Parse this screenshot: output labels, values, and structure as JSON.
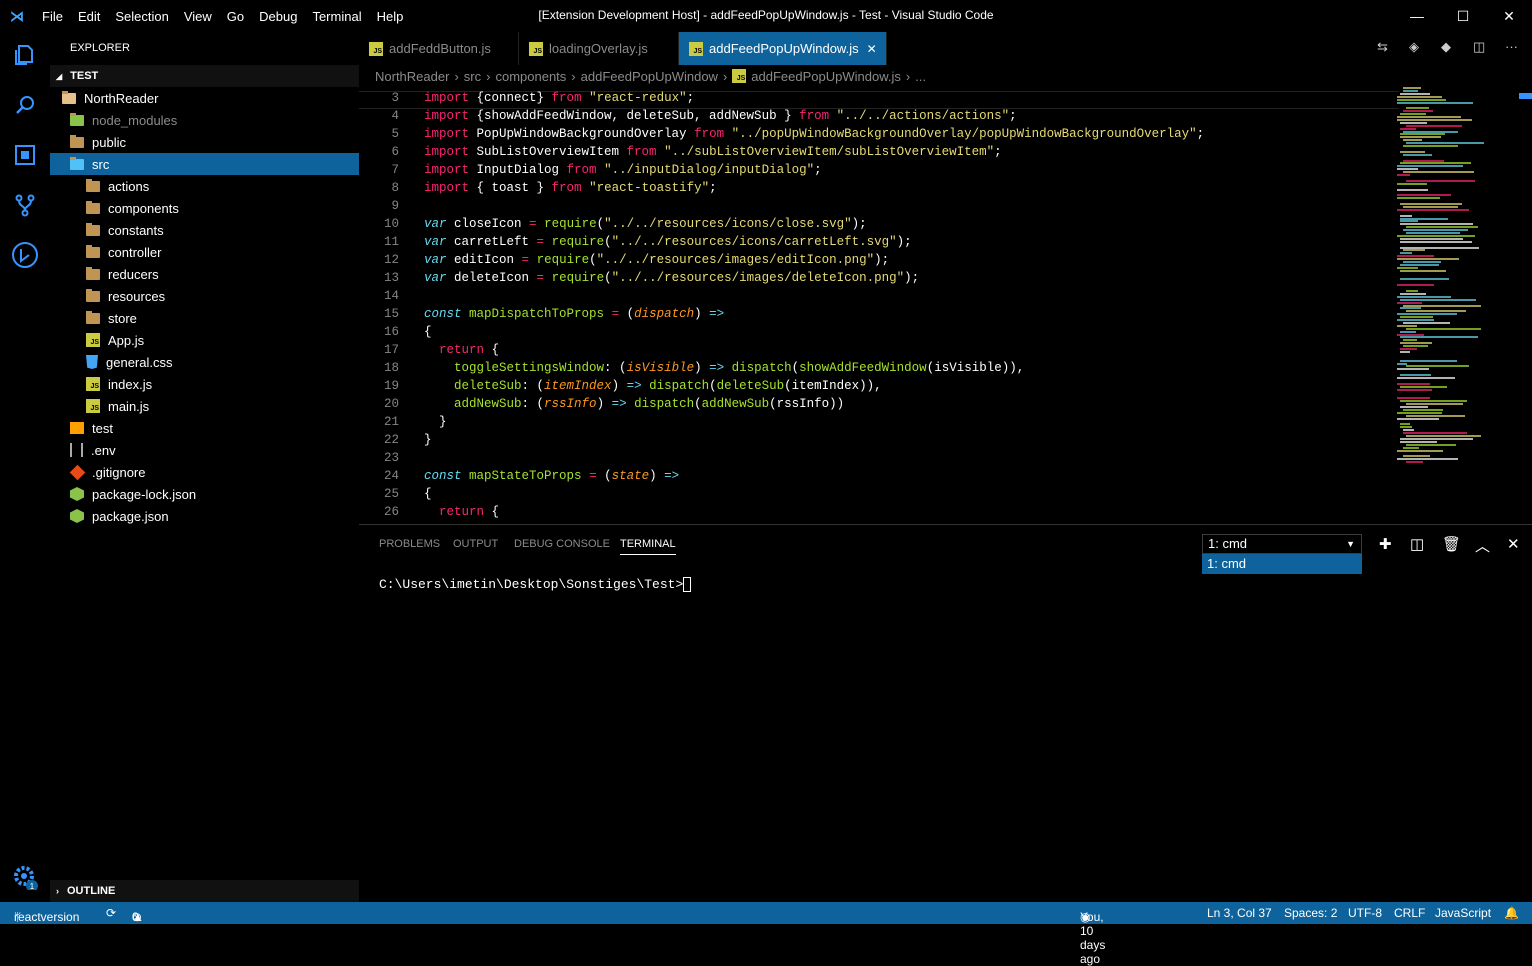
{
  "titlebar": {
    "menu": [
      "File",
      "Edit",
      "Selection",
      "View",
      "Go",
      "Debug",
      "Terminal",
      "Help"
    ],
    "title": "[Extension Development Host] - addFeedPopUpWindow.js - Test - Visual Studio Code"
  },
  "sidebar": {
    "title": "EXPLORER",
    "section": "TEST",
    "outline": "OUTLINE",
    "items": [
      {
        "label": "NorthReader",
        "type": "folder-open",
        "depth": 0
      },
      {
        "label": "node_modules",
        "type": "node-folder",
        "depth": 1,
        "dim": true
      },
      {
        "label": "public",
        "type": "folder",
        "depth": 1
      },
      {
        "label": "src",
        "type": "src-folder",
        "depth": 1,
        "selected": true
      },
      {
        "label": "actions",
        "type": "folder",
        "depth": 2
      },
      {
        "label": "components",
        "type": "folder",
        "depth": 2
      },
      {
        "label": "constants",
        "type": "folder",
        "depth": 2
      },
      {
        "label": "controller",
        "type": "folder",
        "depth": 2
      },
      {
        "label": "reducers",
        "type": "folder",
        "depth": 2
      },
      {
        "label": "resources",
        "type": "folder",
        "depth": 2
      },
      {
        "label": "store",
        "type": "folder",
        "depth": 2
      },
      {
        "label": "App.js",
        "type": "js",
        "depth": 2
      },
      {
        "label": "general.css",
        "type": "css",
        "depth": 2
      },
      {
        "label": "index.js",
        "type": "js",
        "depth": 2
      },
      {
        "label": "main.js",
        "type": "js",
        "depth": 2
      },
      {
        "label": "test",
        "type": "test",
        "depth": 1
      },
      {
        "label": ".env",
        "type": "env",
        "depth": 1
      },
      {
        "label": ".gitignore",
        "type": "git",
        "depth": 1
      },
      {
        "label": "package-lock.json",
        "type": "node",
        "depth": 1
      },
      {
        "label": "package.json",
        "type": "node",
        "depth": 1
      }
    ]
  },
  "tabs": [
    {
      "label": "addFeddButton.js",
      "active": false
    },
    {
      "label": "loadingOverlay.js",
      "active": false
    },
    {
      "label": "addFeedPopUpWindow.js",
      "active": true
    }
  ],
  "breadcrumb": [
    "NorthReader",
    "src",
    "components",
    "addFeedPopUpWindow",
    "addFeedPopUpWindow.js",
    "..."
  ],
  "editor": {
    "line_numbers": [
      "3",
      "4",
      "5",
      "6",
      "7",
      "8",
      "9",
      "10",
      "11",
      "12",
      "13",
      "14",
      "15",
      "16",
      "17",
      "18",
      "19",
      "20",
      "21",
      "22",
      "23",
      "24",
      "25",
      "26"
    ]
  },
  "panel": {
    "tabs": [
      "PROBLEMS",
      "OUTPUT",
      "DEBUG CONSOLE",
      "TERMINAL"
    ],
    "terminal_select": "1: cmd",
    "terminal_option": "1: cmd",
    "prompt": "C:\\Users\\imetin\\Desktop\\Sonstiges\\Test>"
  },
  "status": {
    "branch": "reactversion",
    "errors": "0",
    "warnings": "0",
    "blame": "You, 10 days ago",
    "position": "Ln 3, Col 37",
    "spaces": "Spaces: 2",
    "encoding": "UTF-8",
    "eol": "CRLF",
    "language": "JavaScript",
    "notifications": "1"
  }
}
